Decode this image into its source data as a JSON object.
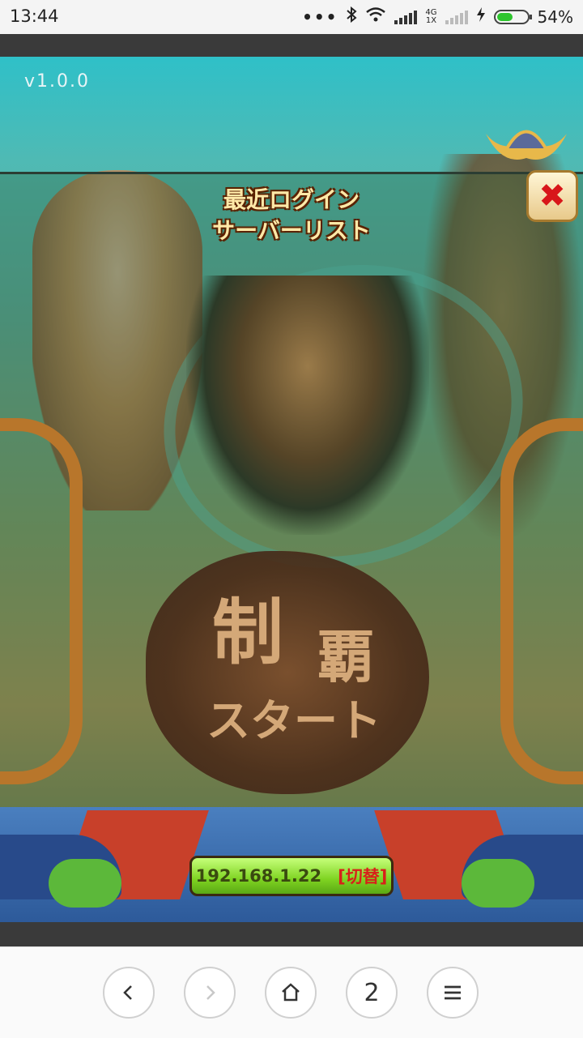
{
  "status_bar": {
    "time": "13:44",
    "dots": "•••",
    "network_label": "4G",
    "network_sub": "1X",
    "battery_percent": "54%",
    "battery_level": 0.54,
    "battery_color": "#2ec52e"
  },
  "game": {
    "version": "v1.0.0",
    "panel_title_line1": "最近ログイン",
    "panel_title_line2": "サーバーリスト",
    "logo_line1": "制",
    "logo_line2": "覇",
    "logo_line3": "スタート",
    "server_ip": "192.168.1.22",
    "server_switch": "[切替]",
    "close_icon": "close-icon"
  },
  "browser_bar": {
    "back_icon": "back-icon",
    "forward_icon": "forward-icon",
    "home_icon": "home-icon",
    "tabs_count": "2",
    "menu_icon": "menu-icon"
  }
}
